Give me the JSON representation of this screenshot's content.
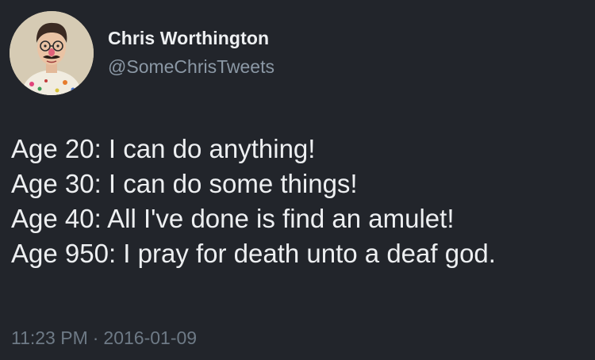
{
  "author": {
    "display_name": "Chris Worthington",
    "handle": "@SomeChrisTweets"
  },
  "tweet": {
    "lines": [
      "Age 20: I can do anything!",
      "Age 30: I can do some things!",
      "Age 40: All I've done is find an amulet!",
      "Age 950: I pray for death unto a deaf god."
    ],
    "time": "11:23 PM",
    "separator": "·",
    "date": "2016-01-09"
  },
  "colors": {
    "background": "#22252b",
    "text": "#edeff1",
    "secondary": "#8b98a5",
    "meta": "#6e7a86"
  }
}
